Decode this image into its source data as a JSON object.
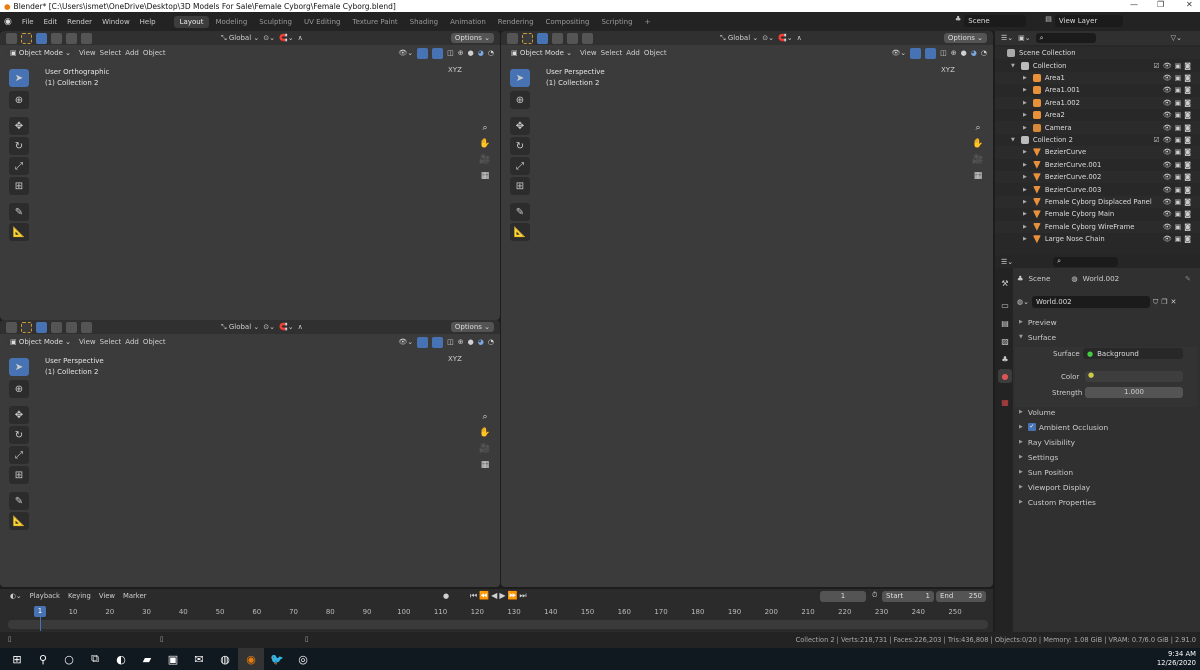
{
  "window": {
    "title": "Blender* [C:\\Users\\ismet\\OneDrive\\Desktop\\3D Models For Sale\\Female Cyborg\\Female Cyborg.blend]",
    "minimize": "—",
    "maximize": "❐",
    "close": "✕"
  },
  "menu": [
    "File",
    "Edit",
    "Render",
    "Window",
    "Help"
  ],
  "workspaces": [
    {
      "label": "Layout",
      "active": true
    },
    {
      "label": "Modeling"
    },
    {
      "label": "Sculpting"
    },
    {
      "label": "UV Editing"
    },
    {
      "label": "Texture Paint"
    },
    {
      "label": "Shading"
    },
    {
      "label": "Animation"
    },
    {
      "label": "Rendering"
    },
    {
      "label": "Compositing"
    },
    {
      "label": "Scripting"
    },
    {
      "label": "+"
    }
  ],
  "scene": {
    "name": "Scene",
    "view_layer": "View Layer"
  },
  "viewport_common": {
    "transform": "Global",
    "options": "Options",
    "mode": "Object Mode",
    "view": "View",
    "select": "Select",
    "add": "Add",
    "object": "Object"
  },
  "viewports": [
    {
      "id": "top-left",
      "view_name": "User Orthographic",
      "collection": "(1) Collection 2"
    },
    {
      "id": "bottom-left",
      "view_name": "User Perspective",
      "collection": "(1) Collection 2"
    },
    {
      "id": "right",
      "view_name": "User Perspective",
      "collection": "(1) Collection 2"
    }
  ],
  "gizmo_axes": {
    "x": "X",
    "y": "Y",
    "z": "Z",
    "x_color": "#e54a5b",
    "y_color": "#7ec22c",
    "z_color": "#3b79d8"
  },
  "outliner": {
    "root": "Scene Collection",
    "rows": [
      {
        "label": "Collection",
        "type": "collection",
        "level": 0
      },
      {
        "label": "Area1",
        "type": "light",
        "level": 1
      },
      {
        "label": "Area1.001",
        "type": "light",
        "level": 1
      },
      {
        "label": "Area1.002",
        "type": "light",
        "level": 1
      },
      {
        "label": "Area2",
        "type": "light",
        "level": 1
      },
      {
        "label": "Camera",
        "type": "camera",
        "level": 1
      },
      {
        "label": "Collection 2",
        "type": "collection",
        "level": 0
      },
      {
        "label": "BezierCurve",
        "type": "mesh",
        "level": 1
      },
      {
        "label": "BezierCurve.001",
        "type": "mesh",
        "level": 1
      },
      {
        "label": "BezierCurve.002",
        "type": "mesh",
        "level": 1
      },
      {
        "label": "BezierCurve.003",
        "type": "mesh",
        "level": 1
      },
      {
        "label": "Female Cyborg Displaced Panel",
        "type": "mesh",
        "level": 1
      },
      {
        "label": "Female Cyborg Main",
        "type": "mesh",
        "level": 1
      },
      {
        "label": "Female Cyborg WireFrame",
        "type": "mesh",
        "level": 1
      },
      {
        "label": "Large Nose Chain",
        "type": "mesh",
        "level": 1
      }
    ]
  },
  "properties": {
    "breadcrumb_scene": "Scene",
    "breadcrumb_world": "World.002",
    "world_name": "World.002",
    "panels_top": [
      "Preview",
      "Surface"
    ],
    "surface_label": "Surface",
    "surface_value": "Background",
    "color_label": "Color",
    "strength_label": "Strength",
    "strength_value": "1.000",
    "panels": [
      {
        "label": "Volume"
      },
      {
        "label": "Ambient Occlusion",
        "checkbox": true
      },
      {
        "label": "Ray Visibility"
      },
      {
        "label": "Settings"
      },
      {
        "label": "Sun Position"
      },
      {
        "label": "Viewport Display"
      },
      {
        "label": "Custom Properties"
      }
    ]
  },
  "timeline": {
    "menus": [
      "Playback",
      "Keying",
      "View",
      "Marker"
    ],
    "current_frame": "1",
    "start_label": "Start",
    "start": "1",
    "end_label": "End",
    "end": "250",
    "ticks": [
      "1",
      "10",
      "20",
      "30",
      "40",
      "50",
      "60",
      "70",
      "80",
      "90",
      "100",
      "110",
      "120",
      "130",
      "140",
      "150",
      "160",
      "170",
      "180",
      "190",
      "200",
      "210",
      "220",
      "230",
      "240",
      "250"
    ]
  },
  "status": "Collection 2 | Verts:218,731 | Faces:226,203 | Tris:436,808 | Objects:0/20 | Memory: 1.08 GiB | VRAM: 0.7/6.0 GiB | 2.91.0",
  "taskbar": {
    "time": "9:34 AM",
    "date": "12/26/2020",
    "apps": [
      "windows-start",
      "search",
      "cortana",
      "task-view",
      "edge",
      "file-explorer",
      "store",
      "mail",
      "firefox",
      "blender",
      "twitter",
      "app"
    ]
  }
}
